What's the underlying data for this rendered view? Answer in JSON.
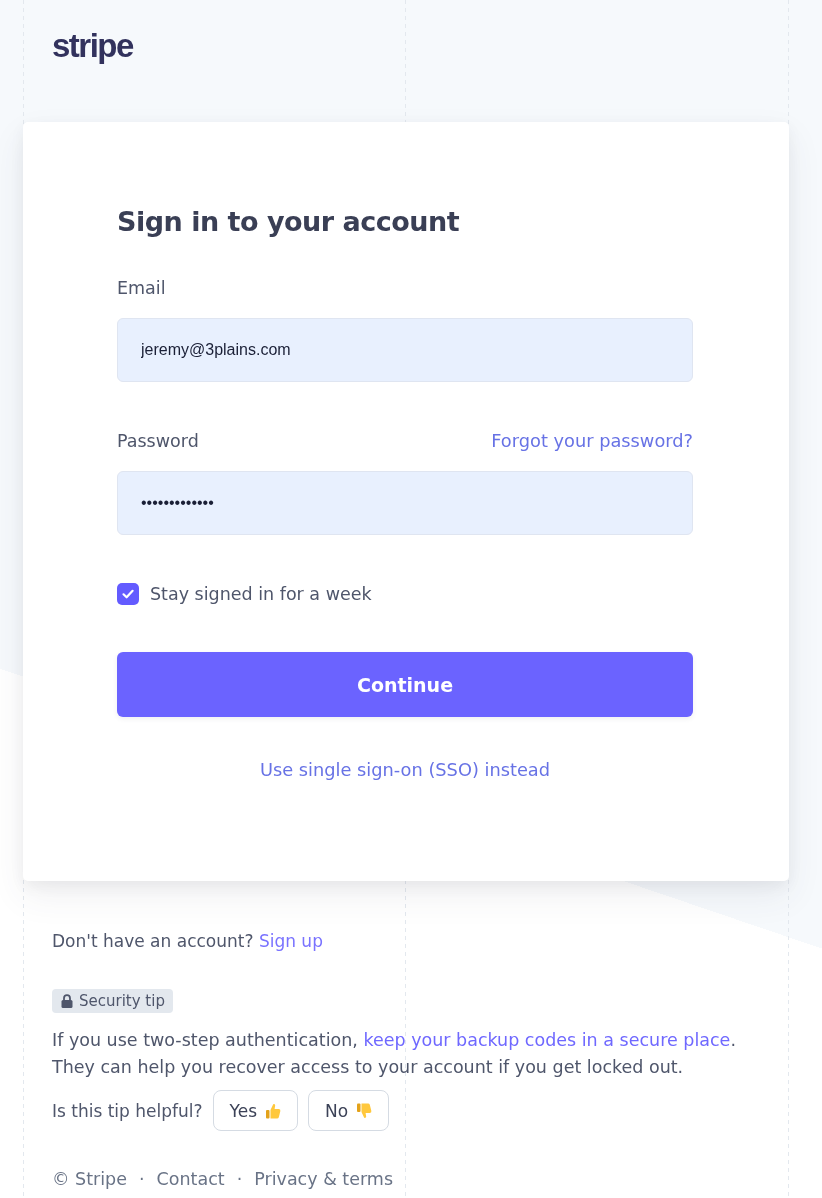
{
  "logo": {
    "text": "stripe"
  },
  "card": {
    "title": "Sign in to your account",
    "fields": [
      {
        "label": "Email",
        "value": "jeremy@3plains.com"
      },
      {
        "label": "Password",
        "link": "Forgot your password?",
        "value": "•••••••••••••"
      }
    ],
    "remember": {
      "label": "Stay signed in for a week",
      "checked": true
    },
    "submit": {
      "label": "Continue"
    },
    "sso_link": "Use single sign-on (SSO) instead"
  },
  "signup": {
    "text": "Don't have an account? ",
    "link": "Sign up"
  },
  "security_tip": {
    "badge": "Security tip",
    "text_before": "If you use two-step authentication, ",
    "link": "keep your backup codes in a secure place",
    "text_after": ". They can help you recover access to your account if you get locked out."
  },
  "feedback": {
    "question": "Is this tip helpful?",
    "buttons": [
      {
        "label": "Yes",
        "kind": "thumbs_up"
      },
      {
        "label": "No",
        "kind": "thumbs_down"
      }
    ]
  },
  "footer": {
    "copyright": "© Stripe",
    "links": [
      {
        "separator": "·",
        "label": "Contact"
      },
      {
        "separator": "·",
        "label": "Privacy & terms"
      }
    ]
  }
}
